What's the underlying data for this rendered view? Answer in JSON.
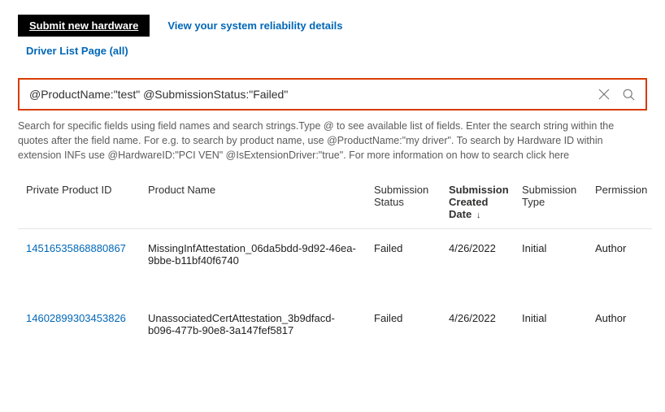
{
  "topbar": {
    "submit_label": "Submit new hardware",
    "reliability_link": "View your system reliability details",
    "driver_list_link": "Driver List Page (all)"
  },
  "search": {
    "value": "@ProductName:\"test\" @SubmissionStatus:\"Failed\""
  },
  "help": {
    "line1": "Search for specific fields using field names and search strings.Type @ to see available list of fields. Enter the search string within the quotes after the field name. For e.g. to search by product name, use @ProductName:\"my driver\". To search by Hardware ID within extension INFs use @HardwareID:\"PCI VEN\" @IsExtensionDriver:\"true\". For more information on how to search click ",
    "here": "here"
  },
  "columns": {
    "id": "Private Product ID",
    "name": "Product Name",
    "status": "Submission Status",
    "date": "Submission Created Date",
    "type": "Submission Type",
    "permission": "Permission"
  },
  "rows": [
    {
      "id": "14516535868880867",
      "name": "MissingInfAttestation_06da5bdd-9d92-46ea-9bbe-b11bf40f6740",
      "status": "Failed",
      "date": "4/26/2022",
      "type": "Initial",
      "permission": "Author"
    },
    {
      "id": "14602899303453826",
      "name": "UnassociatedCertAttestation_3b9dfacd-b096-477b-90e8-3a147fef5817",
      "status": "Failed",
      "date": "4/26/2022",
      "type": "Initial",
      "permission": "Author"
    }
  ]
}
